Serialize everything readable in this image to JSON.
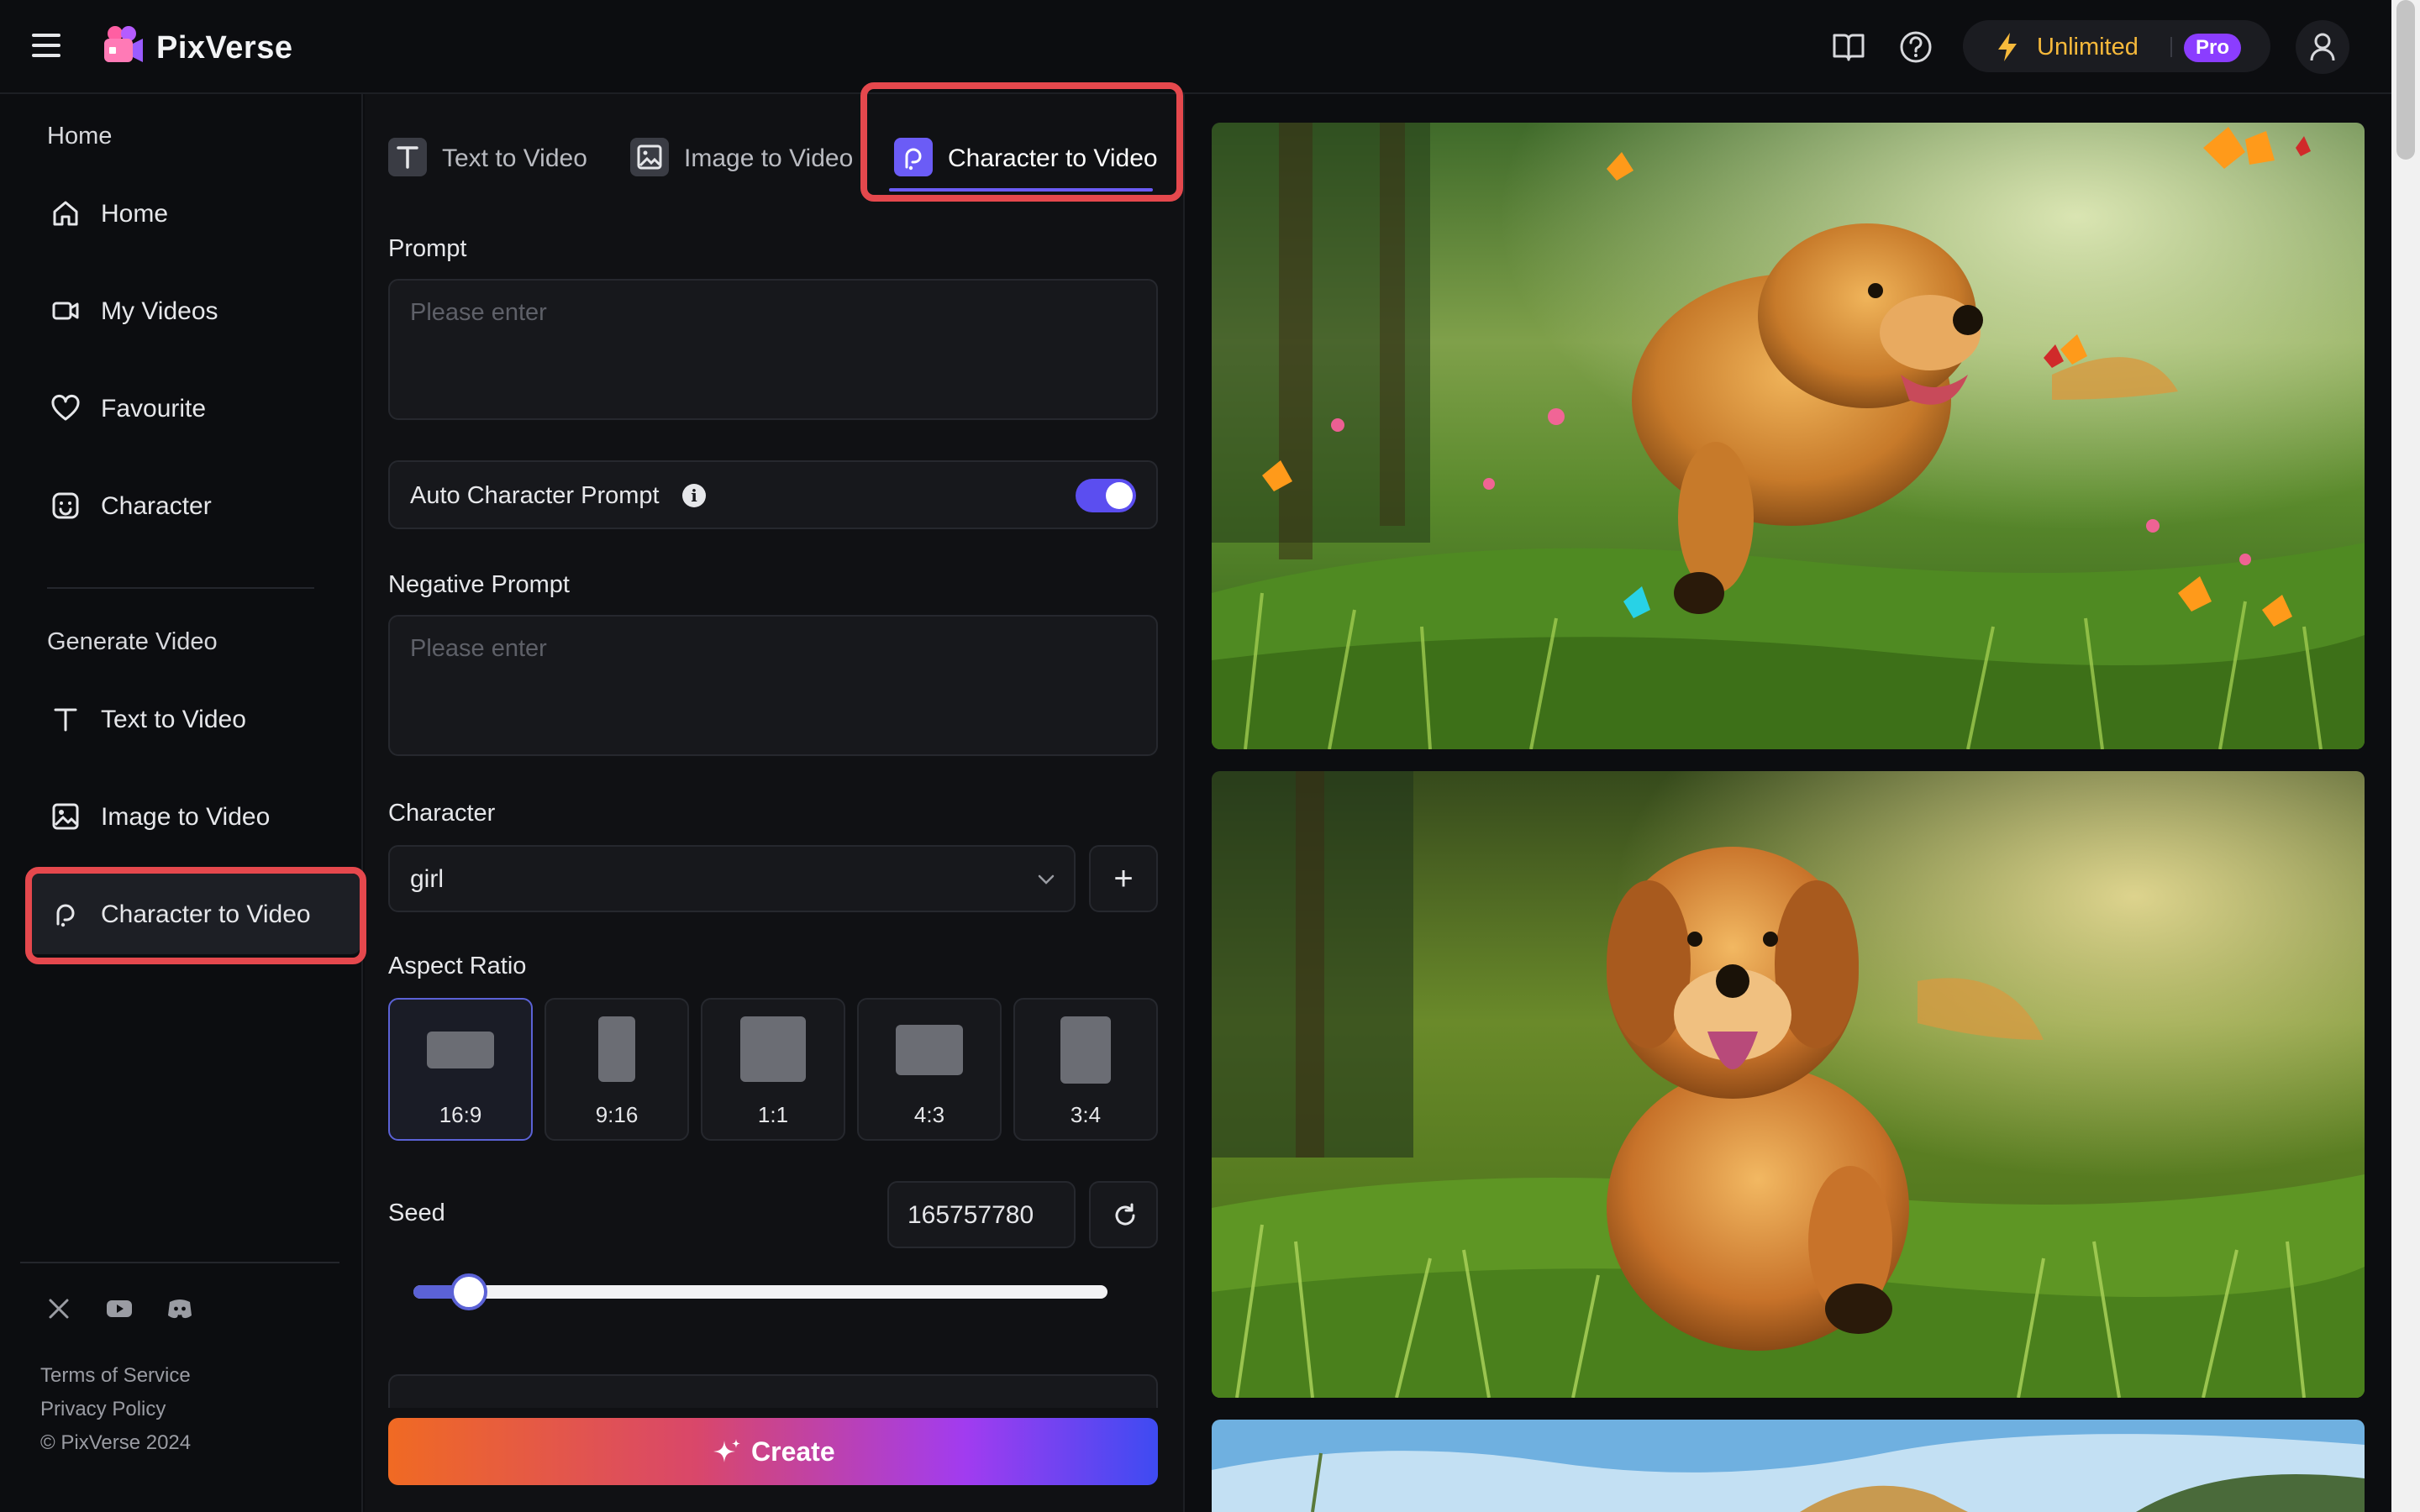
{
  "app": {
    "brand": "PixVerse"
  },
  "topbar": {
    "plan_label": "Unlimited",
    "plan_badge": "Pro",
    "icons": [
      "menu-icon",
      "logo-icon",
      "book-icon",
      "help-icon",
      "bolt-icon",
      "user-icon"
    ]
  },
  "sidebar": {
    "home_section": "Home",
    "generate_section": "Generate Video",
    "items": [
      {
        "label": "Home",
        "icon": "home-icon"
      },
      {
        "label": "My Videos",
        "icon": "video-icon"
      },
      {
        "label": "Favourite",
        "icon": "heart-icon"
      },
      {
        "label": "Character",
        "icon": "character-icon"
      },
      {
        "label": "Text to Video",
        "icon": "text-icon"
      },
      {
        "label": "Image to Video",
        "icon": "image-icon"
      },
      {
        "label": "Character to Video",
        "icon": "character-video-icon",
        "active": true
      }
    ],
    "social": [
      "x-icon",
      "youtube-icon",
      "discord-icon"
    ],
    "footer": {
      "terms": "Terms of Service",
      "privacy": "Privacy Policy",
      "copyright": "© PixVerse 2024"
    }
  },
  "tabs": [
    {
      "label": "Text to Video",
      "icon": "text-icon"
    },
    {
      "label": "Image to Video",
      "icon": "image-icon"
    },
    {
      "label": "Character to Video",
      "icon": "character-video-icon",
      "active": true
    }
  ],
  "form": {
    "prompt_label": "Prompt",
    "prompt_placeholder": "Please enter",
    "prompt_value": "",
    "auto_prompt_label": "Auto Character Prompt",
    "auto_prompt_enabled": true,
    "negative_label": "Negative Prompt",
    "negative_placeholder": "Please enter",
    "negative_value": "",
    "character_label": "Character",
    "character_value": "girl",
    "add_character": "+",
    "aspect_label": "Aspect Ratio",
    "aspect_ratios": [
      "16:9",
      "9:16",
      "1:1",
      "4:3",
      "3:4"
    ],
    "aspect_selected": "16:9",
    "seed_label": "Seed",
    "seed_value": "165757780",
    "seed_slider_fraction": 0.08,
    "create_label": "Create"
  },
  "gallery": {
    "cards": [
      "golden-retriever-butterflies",
      "golden-retriever-meadow",
      "partial-card"
    ]
  },
  "colors": {
    "accent": "#5b62d6",
    "plan": "#f6b93b",
    "pro_badge": "#8b3dff",
    "highlight": "#e5484d"
  }
}
